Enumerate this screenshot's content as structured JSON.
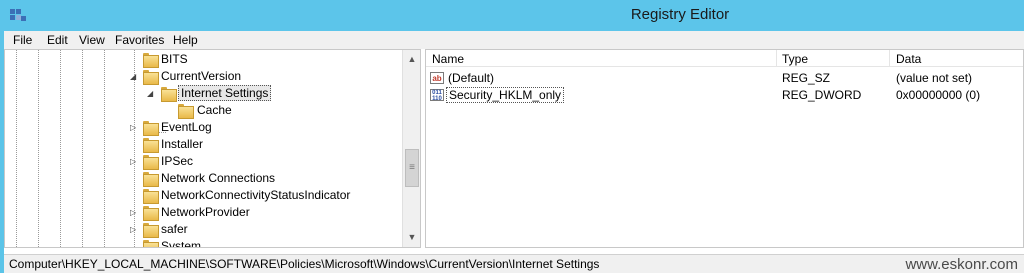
{
  "window": {
    "title": "Registry Editor",
    "icon": "registry-editor-icon"
  },
  "menu": [
    "File",
    "Edit",
    "View",
    "Favorites",
    "Help"
  ],
  "tree": {
    "items": [
      {
        "label": "BITS",
        "level": 0,
        "expander": ""
      },
      {
        "label": "CurrentVersion",
        "level": 0,
        "expander": "◢"
      },
      {
        "label": "Internet Settings",
        "level": 1,
        "expander": "◢",
        "selected": true
      },
      {
        "label": "Cache",
        "level": 2,
        "expander": ""
      },
      {
        "label": "EventLog",
        "level": 0,
        "expander": "▷"
      },
      {
        "label": "Installer",
        "level": 0,
        "expander": ""
      },
      {
        "label": "IPSec",
        "level": 0,
        "expander": "▷"
      },
      {
        "label": "Network Connections",
        "level": 0,
        "expander": ""
      },
      {
        "label": "NetworkConnectivityStatusIndicator",
        "level": 0,
        "expander": ""
      },
      {
        "label": "NetworkProvider",
        "level": 0,
        "expander": "▷"
      },
      {
        "label": "safer",
        "level": 0,
        "expander": "▷"
      },
      {
        "label": "System",
        "level": 0,
        "expander": ""
      }
    ],
    "scroll_up": "▲",
    "scroll_down": "▼",
    "scroll_grip": "≡"
  },
  "list": {
    "columns": [
      "Name",
      "Type",
      "Data"
    ],
    "rows": [
      {
        "icon": "ab",
        "icon_name": "string-value-icon",
        "name": "(Default)",
        "type": "REG_SZ",
        "data": "(value not set)"
      },
      {
        "icon": "011 110",
        "icon_name": "binary-value-icon",
        "name": "Security_HKLM_only",
        "type": "REG_DWORD",
        "data": "0x00000000 (0)"
      }
    ]
  },
  "status": {
    "path": "Computer\\HKEY_LOCAL_MACHINE\\SOFTWARE\\Policies\\Microsoft\\Windows\\CurrentVersion\\Internet Settings",
    "watermark": "www.eskonr.com"
  },
  "colors": {
    "titlebar": "#5cc5ea",
    "chrome": "#f0f0f0"
  }
}
